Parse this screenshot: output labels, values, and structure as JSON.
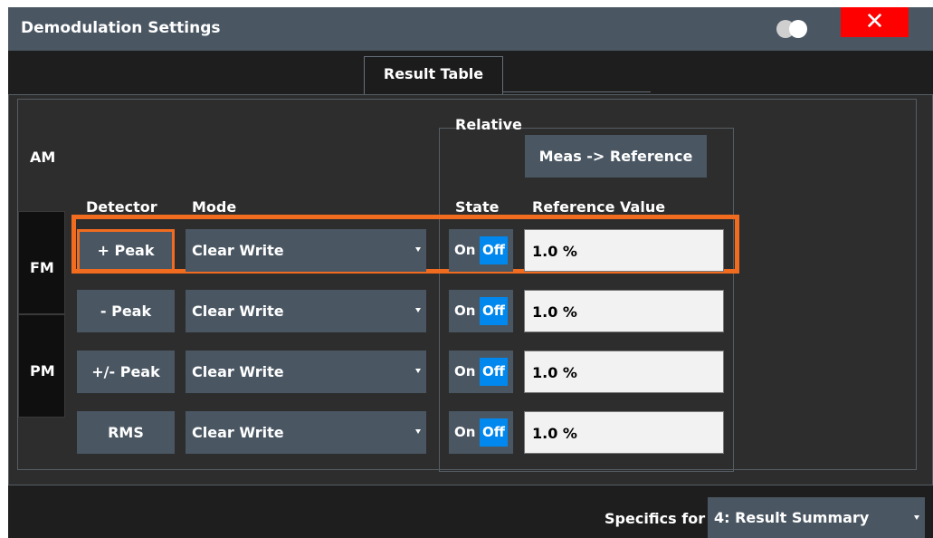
{
  "dialog": {
    "title": "Demodulation Settings",
    "close_label": "✕"
  },
  "tabs": [
    {
      "label": "Result Table"
    }
  ],
  "side_tabs": [
    {
      "label": "AM"
    },
    {
      "label": "FM"
    },
    {
      "label": "PM"
    }
  ],
  "columns": {
    "detector": "Detector",
    "mode": "Mode",
    "relative": "Relative",
    "state": "State",
    "reference_value": "Reference Value"
  },
  "meas_button": "Meas -> Reference",
  "rows": [
    {
      "detector": "+ Peak",
      "mode": "Clear Write",
      "on": "On",
      "off": "Off",
      "reference": "1.0 %",
      "selected": true
    },
    {
      "detector": "- Peak",
      "mode": "Clear Write",
      "on": "On",
      "off": "Off",
      "reference": "1.0 %",
      "selected": false
    },
    {
      "detector": "+/- Peak",
      "mode": "Clear Write",
      "on": "On",
      "off": "Off",
      "reference": "1.0 %",
      "selected": false
    },
    {
      "detector": "RMS",
      "mode": "Clear Write",
      "on": "On",
      "off": "Off",
      "reference": "1.0 %",
      "selected": false
    }
  ],
  "footer": {
    "specifics_label": "Specifics for",
    "specifics_value": "4: Result Summary"
  },
  "colors": {
    "highlight": "#f26c1f",
    "toggle_active": "#0088ee",
    "close": "#ff0000"
  }
}
